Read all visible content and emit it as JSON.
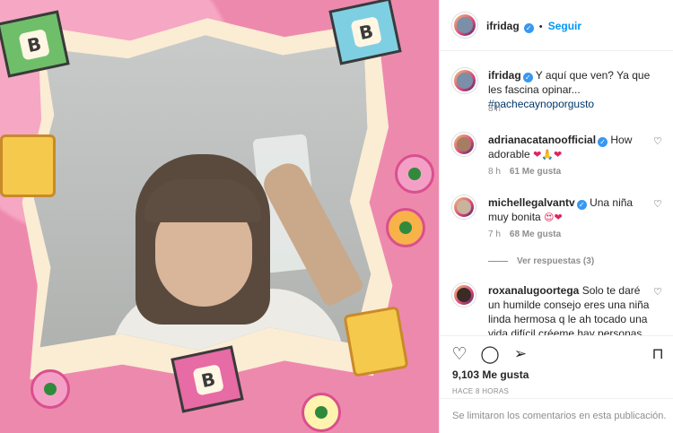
{
  "post": {
    "author": "ifridag",
    "follow_label": "Seguir",
    "more_icon": "more-options-icon"
  },
  "caption": {
    "author": "ifridag",
    "text": "Y aquí que ven? Ya que les fascina opinar...",
    "hashtag": "#pachecaynoporgusto",
    "time": "8 h"
  },
  "comments": [
    {
      "user": "adrianacatanoofficial",
      "text": "How adorable",
      "emoji": "❤🙏❤",
      "time": "8 h",
      "likes": "61 Me gusta"
    },
    {
      "user": "michellegalvantv",
      "text": "Una niña muy bonita",
      "emoji": "😍❤",
      "time": "7 h",
      "likes": "68 Me gusta"
    },
    {
      "user": "roxanalugoortega",
      "text": "Solo te daré un humilde consejo eres una niña linda hermosa q le ah tocado una vida difícil créeme hay personas"
    }
  ],
  "replies_label": "Ver respuestas (3)",
  "actions": {
    "like_icon": "heart-icon",
    "comment_icon": "comment-icon",
    "share_icon": "share-icon",
    "save_icon": "bookmark-icon"
  },
  "likes_label": "9,103 Me gusta",
  "posted_time": "HACE 8 HORAS",
  "footer_note": "Se limitaron los comentarios en esta publicación."
}
